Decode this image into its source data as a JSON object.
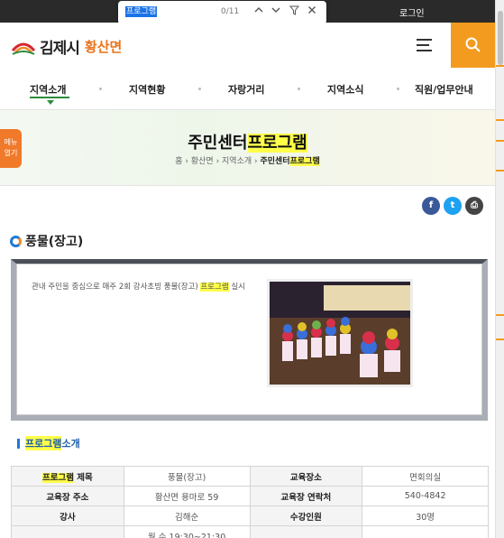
{
  "topbar": {
    "login_label": "로그인"
  },
  "find": {
    "query": "프로그램",
    "count": "0/11"
  },
  "header": {
    "city_name": "김제시",
    "town_name": "황산면"
  },
  "nav": {
    "items": [
      "지역소개",
      "지역현황",
      "자랑거리",
      "지역소식",
      "직원/업무안내"
    ]
  },
  "banner": {
    "title_prefix": "주민센터",
    "title_highlight": "프로그램",
    "breadcrumb": [
      "홈",
      "황산면",
      "지역소개"
    ],
    "breadcrumb_current_prefix": "주민센터",
    "breadcrumb_current_highlight": "프로그램"
  },
  "side_menu": {
    "line1": "메뉴",
    "line2": "열기"
  },
  "share": {
    "facebook": "f",
    "twitter": "t",
    "print": "⎙"
  },
  "section": {
    "title": "풍물(장고)"
  },
  "program": {
    "desc_prefix": "관내 주민을 중심으로 매주 2회 강사초빙 풍물(장고) ",
    "desc_highlight": "프로그램",
    "desc_suffix": " 실시"
  },
  "intro": {
    "highlight": "프로그램",
    "suffix": "소개"
  },
  "table": {
    "r1": {
      "h1_highlight": "프로그램",
      "h1_suffix": " 제목",
      "v1": "풍물(장고)",
      "h2": "교육장소",
      "v2": "면회의실"
    },
    "r2": {
      "h1": "교육장 주소",
      "v1": "황산면 용마로 59",
      "h2": "교육장 연락처",
      "v2": "540-4842"
    },
    "r3": {
      "h1": "강사",
      "v1": "김해순",
      "h2": "수강인원",
      "v2": "30명"
    },
    "r4": {
      "v1": "월 수 19:30~21:30"
    }
  },
  "colors": {
    "accent": "#f39b1f",
    "nav_active": "#2e8b3e",
    "highlight": "#ffff4a"
  }
}
